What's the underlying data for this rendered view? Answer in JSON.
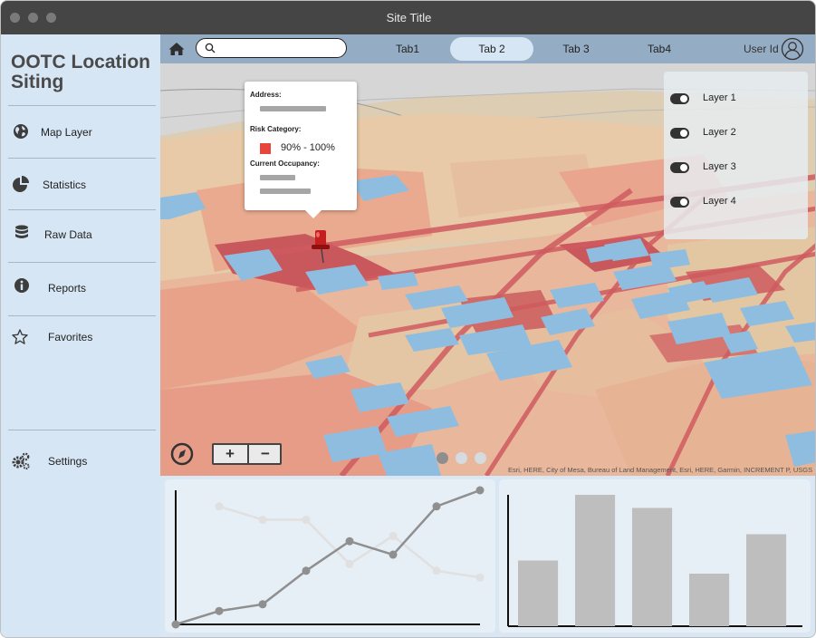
{
  "window": {
    "title": "Site Title"
  },
  "sidebar": {
    "app_title": "OOTC Location Siting",
    "items": [
      {
        "label": "Map Layer",
        "icon": "globe-icon"
      },
      {
        "label": "Statistics",
        "icon": "pie-chart-icon"
      },
      {
        "label": "Raw Data",
        "icon": "database-icon"
      },
      {
        "label": "Reports",
        "icon": "info-icon"
      },
      {
        "label": "Favorites",
        "icon": "star-icon"
      },
      {
        "label": "Settings",
        "icon": "gears-icon"
      }
    ]
  },
  "topbar": {
    "search": {
      "value": "",
      "placeholder": ""
    },
    "tabs": [
      {
        "label": "Tab1",
        "active": false
      },
      {
        "label": "Tab 2",
        "active": true
      },
      {
        "label": "Tab 3",
        "active": false
      },
      {
        "label": "Tab4",
        "active": false
      }
    ],
    "user_label": "User Id"
  },
  "map": {
    "popup": {
      "address_label": "Address:",
      "risk_label": "Risk Category:",
      "risk_value": "90% - 100%",
      "risk_color": "#e8453c",
      "occupancy_label": "Current Occupancy:"
    },
    "layers": [
      {
        "label": "Layer 1",
        "on": true
      },
      {
        "label": "Layer 2",
        "on": true
      },
      {
        "label": "Layer 3",
        "on": true
      },
      {
        "label": "Layer 4",
        "on": true
      }
    ],
    "zoom": {
      "in_label": "+",
      "out_label": "−"
    },
    "pager": {
      "count": 3,
      "active_index": 0
    },
    "attribution": "Esri, HERE, City of Mesa, Bureau of Land Management, Esri, HERE, Garmin, INCREMENT P, USGS"
  },
  "colors": {
    "sidebar_bg": "#d6e6f4",
    "topbar_bg": "#95adc4",
    "map_high_risk": "#c9585c",
    "map_medium_risk": "#e9a58d",
    "map_low_risk": "#e3c9a0",
    "map_buildings": "#8fbde0"
  },
  "chart_data": [
    {
      "type": "line",
      "title": "",
      "xlabel": "",
      "ylabel": "",
      "x": [
        0,
        1,
        2,
        3,
        4,
        5,
        6,
        7
      ],
      "ylim": [
        0,
        100
      ],
      "series": [
        {
          "values": [
            0,
            10,
            15,
            40,
            62,
            52,
            88,
            100
          ],
          "color": "#8f8f8f"
        },
        {
          "values": [
            null,
            88,
            78,
            78,
            45,
            66,
            40,
            35
          ],
          "color": "#e0e0e0"
        }
      ]
    },
    {
      "type": "bar",
      "title": "",
      "xlabel": "",
      "ylabel": "",
      "categories": [
        "",
        "",
        "",
        "",
        ""
      ],
      "values": [
        50,
        100,
        90,
        40,
        70
      ],
      "ylim": [
        0,
        100
      ],
      "color": "#bebebe"
    }
  ]
}
